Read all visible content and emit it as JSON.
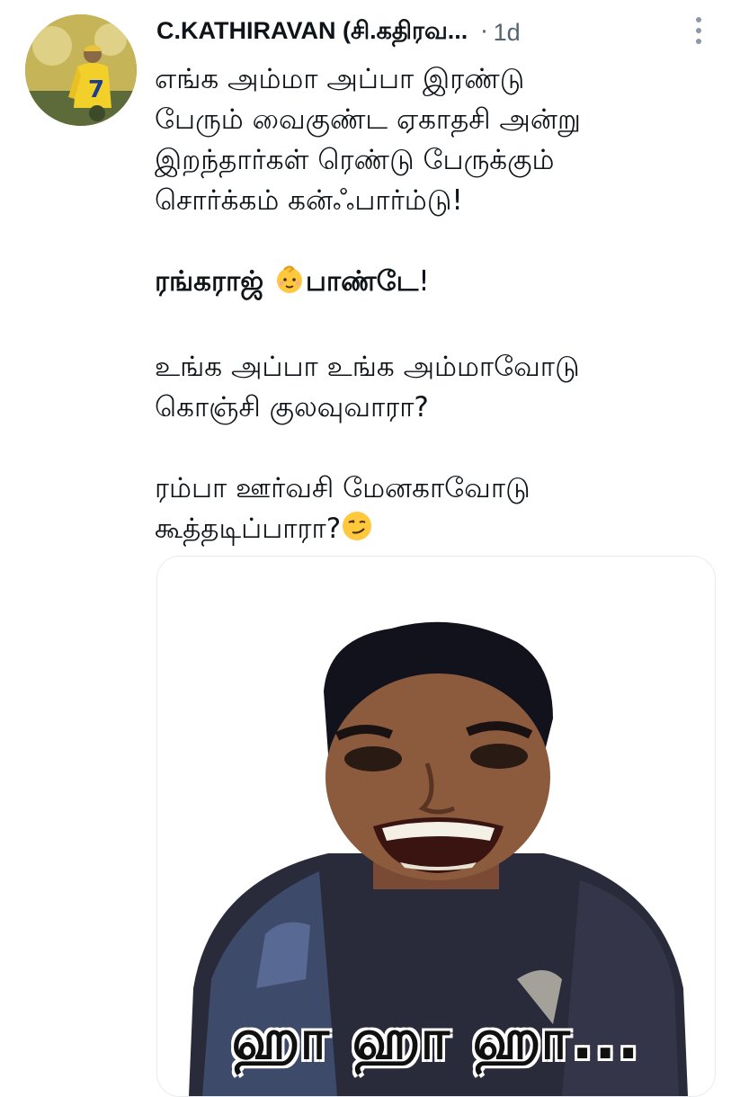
{
  "tweet": {
    "author": {
      "display_name": "C.KATHIRAVAN (சி.கதிரவ...",
      "avatar_icon": "profile-avatar-cricketer-yellow-jersey"
    },
    "separator": "·",
    "timestamp": "1d",
    "more_icon": "more-vertical-icon",
    "text": {
      "para1": [
        "எங்க அம்மா அப்பா இரண்டு",
        "பேரும் வைகுண்ட ஏகாதசி அன்று",
        "இறந்தார்கள் ரெண்டு பேருக்கும்",
        "சொர்க்கம் கன்ஃபார்ம்டு!"
      ],
      "para2_part1": "ரங்கராஜ் ",
      "para2_emoji": "baby-emoji",
      "para2_part2": "பாண்டே",
      "para2_end": "!",
      "para3": [
        " உங்க அப்பா உங்க அம்மாவோடு",
        "கொஞ்சி குலவுவாரா?"
      ],
      "para4_line1": " ரம்பா ஊர்வசி மேனகாவோடு",
      "para4_line2": "கூத்தடிப்பாரா?",
      "para4_emoji": "smirking-face-emoji"
    },
    "media": {
      "image_icon": "laughing-man-meme-image",
      "caption": "ஹா ஹா ஹா..."
    },
    "colors": {
      "text": "#0f1419",
      "secondary": "#536471",
      "border": "#e6ecf0"
    }
  }
}
